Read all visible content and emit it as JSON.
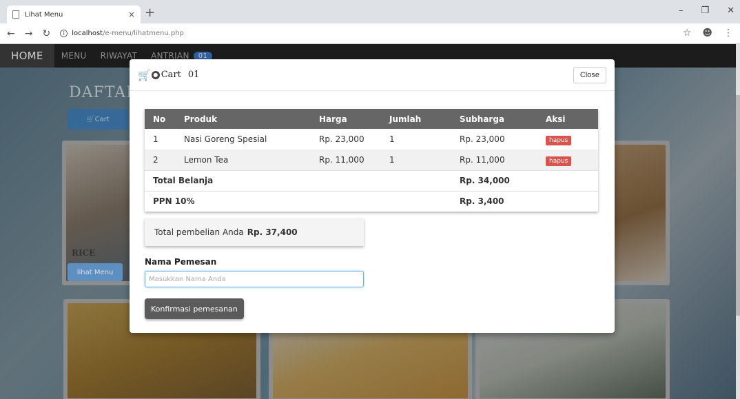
{
  "browser": {
    "tab_title": "Lihat Menu",
    "tab_close": "×",
    "new_tab": "+",
    "url_host": "localhost",
    "url_path": "/e-menu/lihatmenu.php"
  },
  "navbar": {
    "items": [
      {
        "label": "HOME"
      },
      {
        "label": "MENU"
      },
      {
        "label": "RIWAYAT"
      },
      {
        "label": "ANTRIAN"
      }
    ],
    "badge": "01"
  },
  "background": {
    "heading": "DAFTAR",
    "cart_button": "Cart",
    "card_label": "RICE",
    "lihat_button": "lihat Menu"
  },
  "modal": {
    "title": "Cart",
    "count": "01",
    "close_label": "Close",
    "table": {
      "headers": [
        "No",
        "Produk",
        "Harga",
        "Jumlah",
        "Subharga",
        "Aksi"
      ],
      "rows": [
        {
          "no": "1",
          "produk": "Nasi Goreng Spesial",
          "harga": "Rp. 23,000",
          "jumlah": "1",
          "subharga": "Rp. 23,000",
          "aksi": "hapus"
        },
        {
          "no": "2",
          "produk": "Lemon Tea",
          "harga": "Rp. 11,000",
          "jumlah": "1",
          "subharga": "Rp. 11,000",
          "aksi": "hapus"
        }
      ],
      "total_label": "Total Belanja",
      "total_value": "Rp. 34,000",
      "ppn_label": "PPN 10%",
      "ppn_value": "Rp. 3,400"
    },
    "grand_total_text": "Total pembelian Anda",
    "grand_total_value": "Rp. 37,400",
    "name_label": "Nama Pemesan",
    "name_placeholder": "Masukkan Nama Anda",
    "confirm_label": "Konfirmasi pemesanan"
  },
  "colors": {
    "hapus": "#d9534f",
    "table_header": "#666666",
    "confirm_button": "#5b5b5b"
  }
}
